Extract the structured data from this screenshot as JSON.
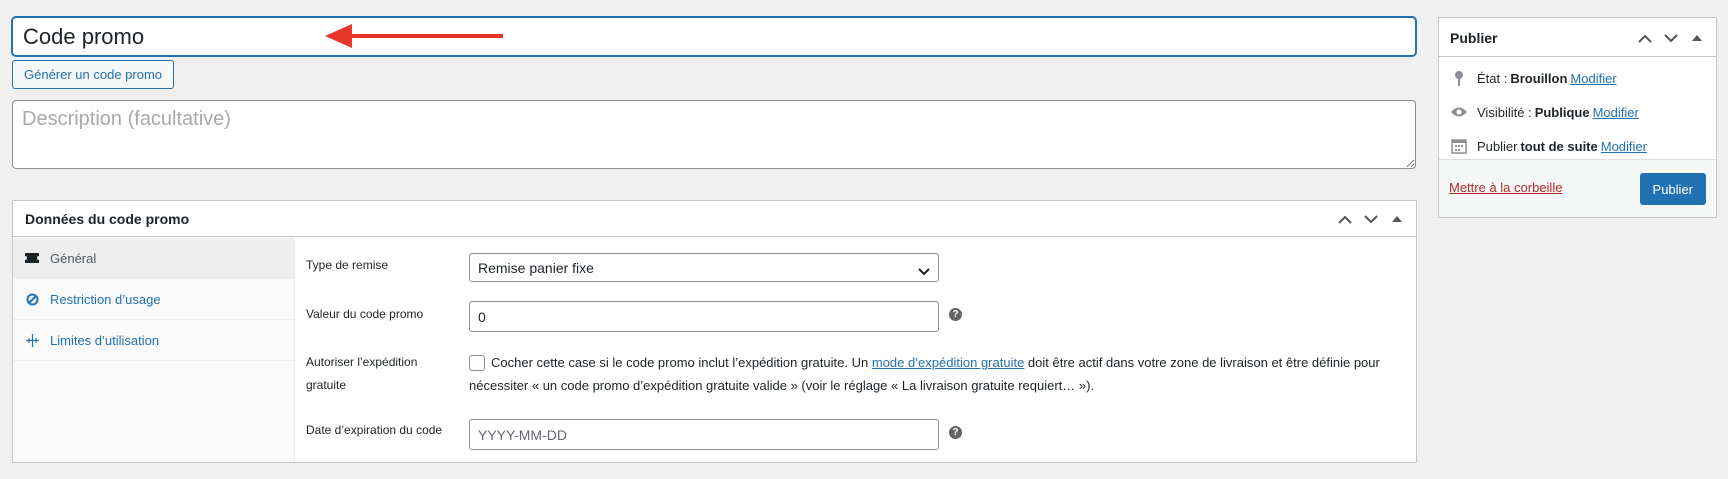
{
  "title": {
    "value": "Code promo"
  },
  "generate_button": {
    "label": "Générer un code promo"
  },
  "description": {
    "placeholder": "Description (facultative)"
  },
  "coupon_data": {
    "title": "Données du code promo",
    "tabs": [
      {
        "label": "Général",
        "icon": "ticket-icon"
      },
      {
        "label": "Restriction d’usage",
        "icon": "block-icon"
      },
      {
        "label": "Limites d’utilisation",
        "icon": "limit-icon"
      }
    ],
    "discount_type": {
      "label": "Type de remise",
      "value": "Remise panier fixe"
    },
    "coupon_amount": {
      "label": "Valeur du code promo",
      "value": "0"
    },
    "free_shipping": {
      "label": "Autoriser l’expédition gratuite",
      "desc_before": "Cocher cette case si le code promo inclut l’expédition gratuite. Un ",
      "link": "mode d’expédition gratuite",
      "desc_after": " doit être actif dans votre zone de livraison et être définie pour nécessiter « un code promo d’expédition gratuite valide » (voir le réglage « La livraison gratuite requiert… »)."
    },
    "expiry_date": {
      "label": "Date d’expiration du code",
      "placeholder": "YYYY-MM-DD"
    },
    "help_glyph": "?"
  },
  "publish": {
    "title": "Publier",
    "status": {
      "label": "État :",
      "value": "Brouillon",
      "link": "Modifier"
    },
    "visibility": {
      "label": "Visibilité :",
      "value": "Publique",
      "link": "Modifier"
    },
    "schedule": {
      "label": "Publier",
      "value": "tout de suite",
      "link": "Modifier"
    },
    "trash": "Mettre à la corbeille",
    "button": "Publier"
  },
  "colors": {
    "accent": "#2271b1",
    "arrow": "#e8352b",
    "trash": "#b32d2e"
  }
}
